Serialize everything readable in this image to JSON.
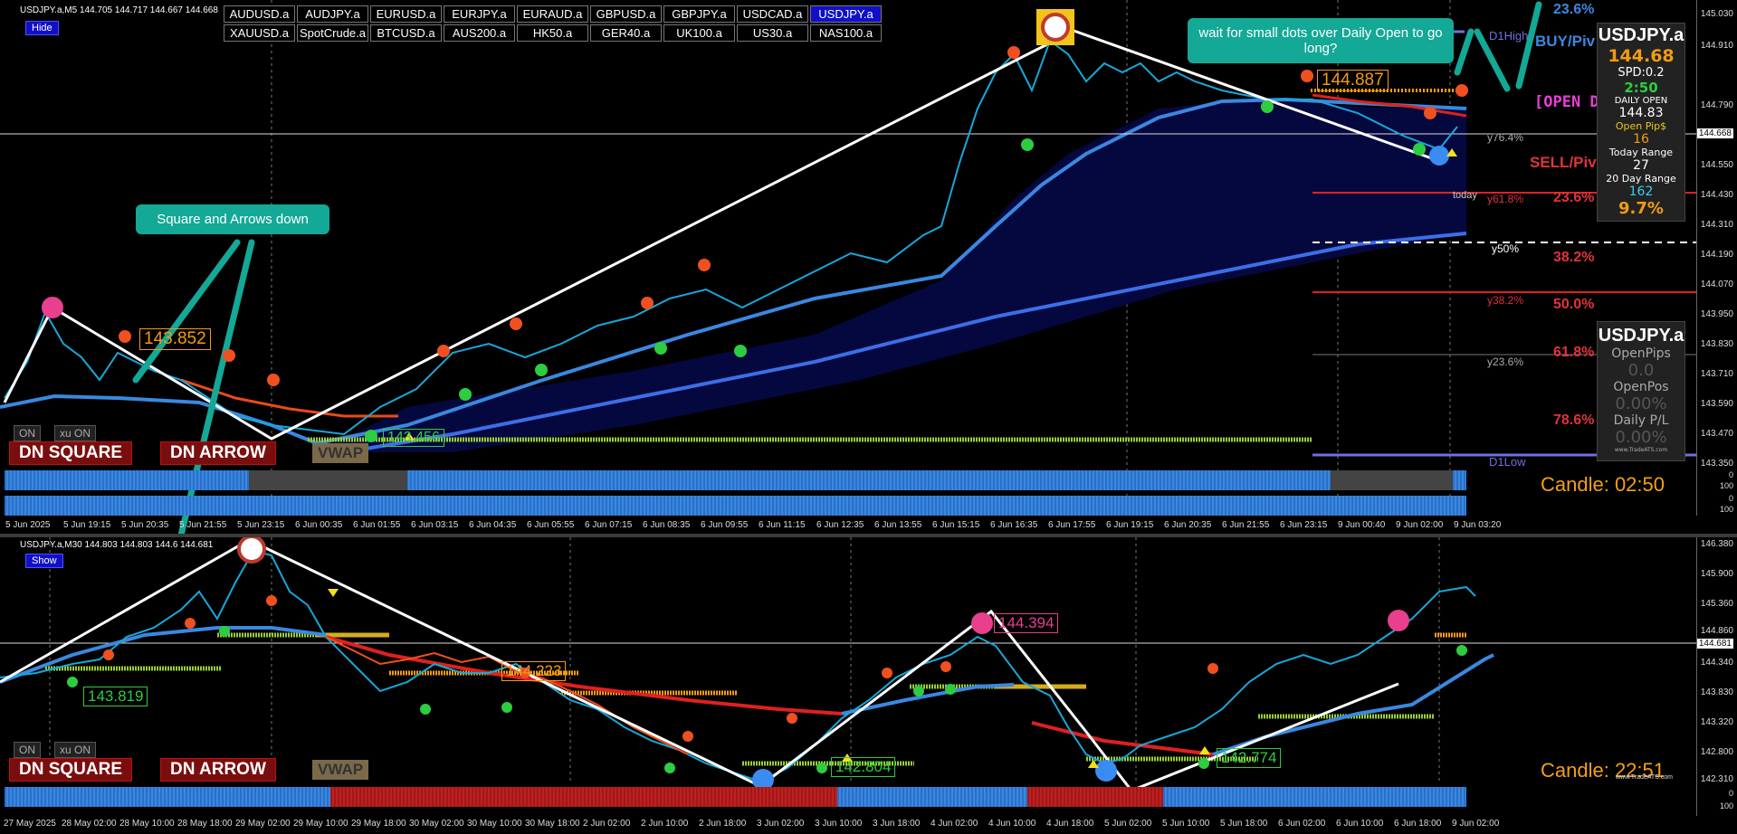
{
  "top": {
    "title": "USDJPY.a,M5  144.705 144.717 144.667 144.668",
    "hide_label": "Hide",
    "symbols_row1": [
      "AUDUSD.a",
      "AUDJPY.a",
      "EURUSD.a",
      "EURJPY.a",
      "EURAUD.a",
      "GBPUSD.a",
      "GBPJPY.a",
      "USDCAD.a",
      "USDJPY.a"
    ],
    "symbols_row2": [
      "XAUUSD.a",
      "SpotCrude.a",
      "BTCUSD.a",
      "AUS200.a",
      "HK50.a",
      "GER40.a",
      "UK100.a",
      "US30.a",
      "NAS100.a"
    ],
    "active_symbol": "USDJPY.a",
    "callout_left": "Square and Arrows down",
    "callout_right": "wait for small dots over Daily Open to go long?",
    "price_tags": [
      "143.852",
      "143.456",
      "144.887"
    ],
    "buttons": {
      "dn_square": "DN SQUARE",
      "dn_arrow": "DN ARROW",
      "vwap": "VWAP",
      "on": "ON",
      "xu_on": "xu ON"
    },
    "d1high": "D1High",
    "d1low": "D1Low",
    "buy_piv": "BUY/Piv",
    "sell_piv": "SELL/Piv",
    "open_d": "[OPEN D",
    "today": "today",
    "fib_levels": [
      "23.6%",
      "23.6%",
      "38.2%",
      "50.0%",
      "61.8%",
      "78.6%"
    ],
    "fib_small": [
      "y76.4%",
      "y61.8%",
      "y50%",
      "y38.2%",
      "y23.6%"
    ],
    "candle_timer": "Candle: 02:50",
    "y_axis": [
      "145.030",
      "144.910",
      "144.790",
      "144.668",
      "144.550",
      "144.430",
      "144.310",
      "144.190",
      "144.070",
      "143.950",
      "143.830",
      "143.710",
      "143.590",
      "143.470",
      "143.350"
    ],
    "x_axis": [
      "5 Jun 2025",
      "5 Jun 19:15",
      "5 Jun 20:35",
      "5 Jun 21:55",
      "5 Jun 23:15",
      "6 Jun 00:35",
      "6 Jun 01:55",
      "6 Jun 03:15",
      "6 Jun 04:35",
      "6 Jun 05:55",
      "6 Jun 07:15",
      "6 Jun 08:35",
      "6 Jun 09:55",
      "6 Jun 11:15",
      "6 Jun 12:35",
      "6 Jun 13:55",
      "6 Jun 15:15",
      "6 Jun 16:35",
      "6 Jun 17:55",
      "6 Jun 19:15",
      "6 Jun 20:35",
      "6 Jun 21:55",
      "6 Jun 23:15",
      "9 Jun 00:40",
      "9 Jun 02:00",
      "9 Jun 03:20"
    ],
    "ind_axis": [
      "0",
      "100",
      "0",
      "100"
    ]
  },
  "panel_info": {
    "symbol": "USDJPY.a",
    "price": "144.68",
    "spd": "SPD:0.2",
    "time": "2:50",
    "daily_open_label": "DAILY OPEN",
    "daily_open": "144.83",
    "open_pips_label": "Open Pip$",
    "open_pips": "16",
    "today_range_label": "Today Range",
    "today_range": "27",
    "day20_label": "20 Day Range",
    "day20": "162",
    "pct": "9.7%"
  },
  "panel_pos": {
    "symbol": "USDJPY.a",
    "open_pips_label": "OpenPips",
    "open_pips": "0.0",
    "open_pos_label": "OpenPos",
    "open_pos": "0.00%",
    "daily_pl_label": "Daily P/L",
    "daily_pl": "0.00%",
    "brand": "www.TradeATS.com"
  },
  "bottom": {
    "title": "USDJPY.a,M30  144.803 144.803 144.6 144.681",
    "show_label": "Show",
    "price_tags": [
      "143.819",
      "144.223",
      "144.394",
      "142.804",
      "142.774"
    ],
    "buttons": {
      "dn_square": "DN SQUARE",
      "dn_arrow": "DN ARROW",
      "vwap": "VWAP",
      "on": "ON",
      "xu_on": "xu ON"
    },
    "candle_timer": "Candle: 22:51",
    "brand": "www.TradeATS.com",
    "y_axis": [
      "146.380",
      "145.900",
      "145.360",
      "144.860",
      "144.681",
      "144.340",
      "143.830",
      "143.320",
      "142.800",
      "142.310"
    ],
    "x_axis": [
      "27 May 2025",
      "28 May 02:00",
      "28 May 10:00",
      "28 May 18:00",
      "29 May 02:00",
      "29 May 10:00",
      "29 May 18:00",
      "30 May 02:00",
      "30 May 10:00",
      "30 May 18:00",
      "2 Jun 02:00",
      "2 Jun 10:00",
      "2 Jun 18:00",
      "3 Jun 02:00",
      "3 Jun 10:00",
      "3 Jun 18:00",
      "4 Jun 02:00",
      "4 Jun 10:00",
      "4 Jun 18:00",
      "5 Jun 02:00",
      "5 Jun 10:00",
      "5 Jun 18:00",
      "6 Jun 02:00",
      "6 Jun 10:00",
      "6 Jun 18:00",
      "9 Jun 02:00"
    ],
    "ind_axis": [
      "0",
      "100"
    ]
  }
}
